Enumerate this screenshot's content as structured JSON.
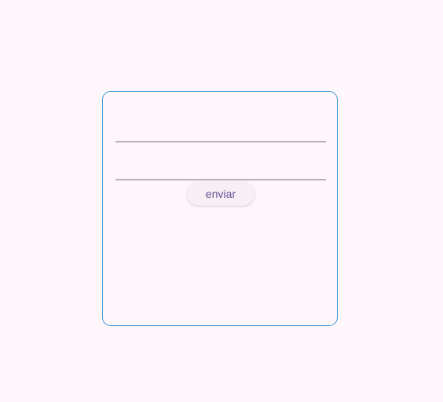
{
  "form": {
    "field_1": {
      "value": "",
      "placeholder": ""
    },
    "field_2": {
      "value": "",
      "placeholder": ""
    },
    "send_label": "enviar"
  },
  "colors": {
    "background": "#fdf7fc",
    "card_border": "#3f95d6",
    "underline": "#b7b1b8",
    "button_text": "#6a4f92",
    "button_bg": "#f6eff6"
  }
}
